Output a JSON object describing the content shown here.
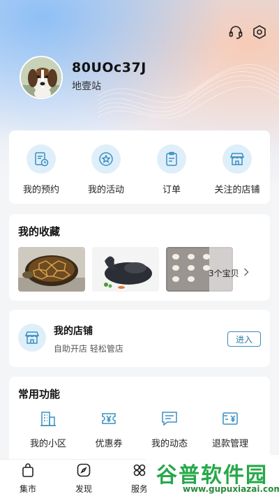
{
  "profile": {
    "username": "80UOc37J",
    "station": "地壹站"
  },
  "header": {
    "icons": [
      "headset-icon",
      "settings-hexagon-icon"
    ]
  },
  "quick_actions": [
    {
      "label": "我的预约",
      "icon": "appointment-icon"
    },
    {
      "label": "我的活动",
      "icon": "activity-star-icon"
    },
    {
      "label": "订单",
      "icon": "order-icon"
    },
    {
      "label": "关注的店铺",
      "icon": "followed-store-icon"
    }
  ],
  "favorites": {
    "title": "我的收藏",
    "items": [
      "turtle-photo",
      "black-chicken-photo",
      "eggs-photo"
    ],
    "more_label": "3个宝贝"
  },
  "my_shop": {
    "title": "我的店铺",
    "subtitle": "自助开店 轻松管店",
    "enter_label": "进入"
  },
  "common_functions": {
    "title": "常用功能",
    "items": [
      {
        "label": "我的小区",
        "icon": "community-building-icon"
      },
      {
        "label": "优惠券",
        "icon": "coupon-icon"
      },
      {
        "label": "我的动态",
        "icon": "message-icon"
      },
      {
        "label": "退款管理",
        "icon": "refund-icon"
      }
    ]
  },
  "tabbar": [
    {
      "label": "集市",
      "icon": "shopping-bag-icon"
    },
    {
      "label": "发现",
      "icon": "compass-icon"
    },
    {
      "label": "服务",
      "icon": "grid-icon"
    }
  ],
  "watermark": {
    "main": "谷普软件园",
    "url": "www.gupuxiazai.com"
  },
  "colors": {
    "accent": "#2a7aa8",
    "icon_bg": "#dfeffa",
    "icon_stroke": "#3a8fc0",
    "watermark": "#27a84a"
  }
}
